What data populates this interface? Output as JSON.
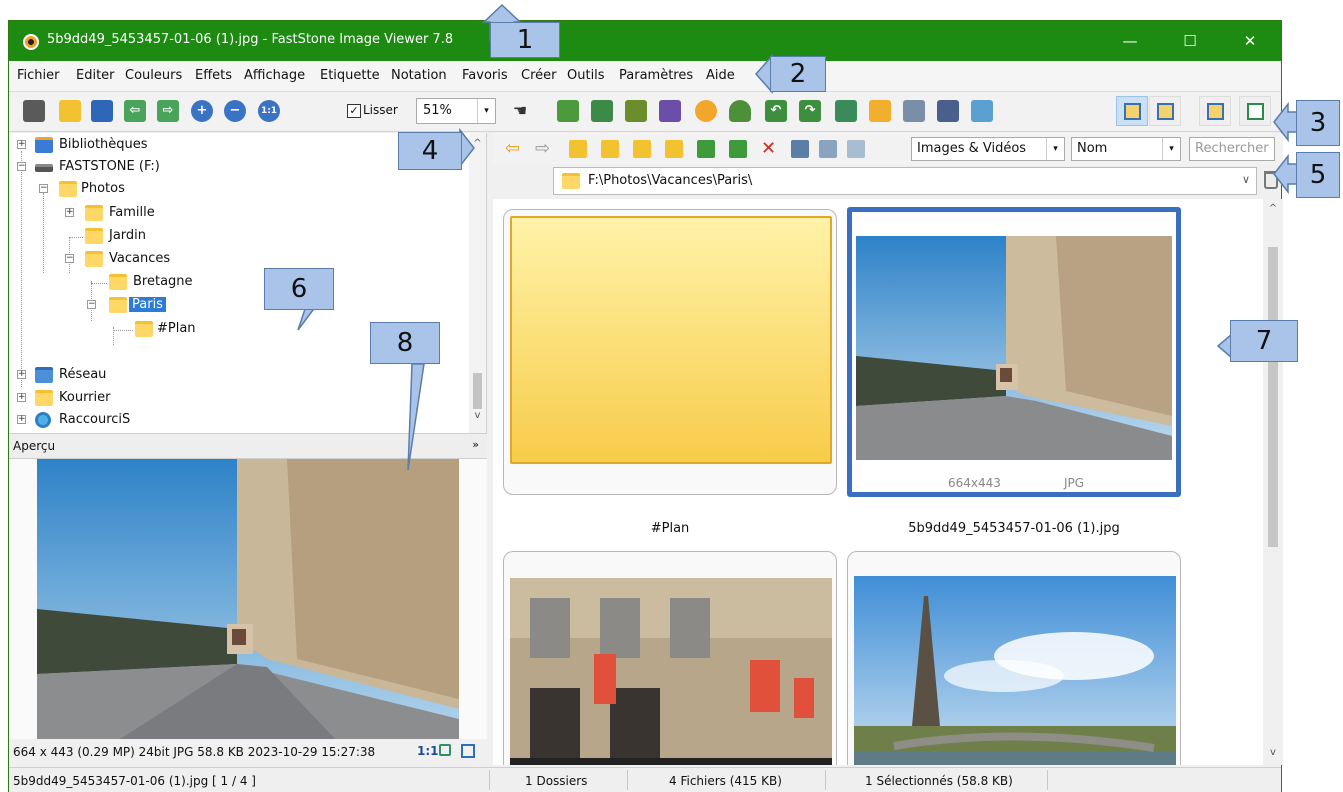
{
  "window": {
    "title": "5b9dd49_5453457-01-06 (1).jpg  -  FastStone Image Viewer 7.8",
    "minimize_label": "—",
    "maximize_label": "☐",
    "close_label": "✕"
  },
  "menu": {
    "items": [
      "Fichier",
      "Editer",
      "Couleurs",
      "Effets",
      "Affichage",
      "Etiquette",
      "Notation",
      "Favoris",
      "Créer",
      "Outils",
      "Paramètres",
      "Aide"
    ]
  },
  "toolbar": {
    "smooth_label": "Lisser",
    "smooth_checked": "✓",
    "zoom_value": "51%",
    "dropdown_arrow": "▾"
  },
  "tree": {
    "items": [
      {
        "label": "Bibliothèques"
      },
      {
        "label": "FASTSTONE (F:)"
      },
      {
        "label": "Photos"
      },
      {
        "label": "Famille"
      },
      {
        "label": "Jardin"
      },
      {
        "label": "Vacances"
      },
      {
        "label": "Bretagne"
      },
      {
        "label": "Paris"
      },
      {
        "label": "#Plan"
      },
      {
        "label": "Réseau"
      },
      {
        "label": "Kourrier"
      },
      {
        "label": "RaccourciS"
      }
    ],
    "expand_plus": "+",
    "expand_minus": "−",
    "scroll_up": "^",
    "scroll_down": "v"
  },
  "preview": {
    "title": "Aperçu",
    "collapse_icon": "»",
    "info": "664 x 443 (0.29 MP)  24bit  JPG   58.8 KB   2023-10-29 15:27:38",
    "ratio": "1:1"
  },
  "browser": {
    "filter_type": "Images & Vidéos",
    "sort_by": "Nom",
    "search_placeholder": "Rechercher",
    "path": "F:\\Photos\\Vacances\\Paris\\",
    "path_dropdown": "∨"
  },
  "thumbnails": [
    {
      "caption": "#Plan"
    },
    {
      "caption": "5b9dd49_5453457-01-06 (1).jpg",
      "dimensions": "664x443",
      "format": "JPG"
    },
    {
      "caption": ""
    },
    {
      "caption": ""
    }
  ],
  "statusbar": {
    "file": "5b9dd49_5453457-01-06 (1).jpg [ 1 / 4 ]",
    "folders": "1 Dossiers",
    "files": "4 Fichiers (415 KB)",
    "selected": "1 Sélectionnés (58.8 KB)"
  },
  "callouts": [
    "1",
    "2",
    "3",
    "4",
    "5",
    "6",
    "7",
    "8"
  ],
  "colors": {
    "title_bar": "#1d8a11",
    "selection": "#2c7bd6",
    "thumb_selected_border": "#3a6fc0",
    "callout_fill": "#a9c4e8"
  }
}
